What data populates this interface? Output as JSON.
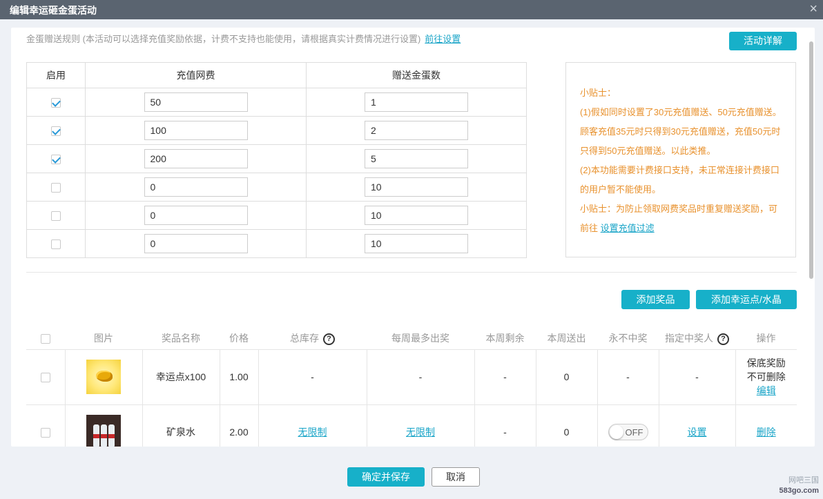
{
  "dialog": {
    "title": "编辑幸运砸金蛋活动",
    "close_icon": "×"
  },
  "rule": {
    "description": "金蛋赠送规则 (本活动可以选择充值奖励依据，计费不支持也能使用，请根据真实计费情况进行设置)",
    "link": "前往设置",
    "detail_button": "活动详解"
  },
  "gift_table": {
    "headers": [
      "启用",
      "充值网费",
      "赠送金蛋数"
    ],
    "rows": [
      {
        "enabled": true,
        "recharge": "50",
        "eggs": "1"
      },
      {
        "enabled": true,
        "recharge": "100",
        "eggs": "2"
      },
      {
        "enabled": true,
        "recharge": "200",
        "eggs": "5"
      },
      {
        "enabled": false,
        "recharge": "0",
        "eggs": "10"
      },
      {
        "enabled": false,
        "recharge": "0",
        "eggs": "10"
      },
      {
        "enabled": false,
        "recharge": "0",
        "eggs": "10"
      }
    ]
  },
  "tips": {
    "title": "小贴士：",
    "line1": "(1)假如同时设置了30元充值赠送、50元充值赠送。顾客充值35元时只得到30元充值赠送，充值50元时只得到50元充值赠送。以此类推。",
    "line2": "(2)本功能需要计费接口支持，未正常连接计费接口的用户暂不能使用。",
    "line3": "小贴士：为防止领取网费奖品时重复赠送奖励，可前往",
    "link": "设置充值过滤"
  },
  "prize_actions": {
    "add_prize": "添加奖品",
    "add_lucky": "添加幸运点/水晶"
  },
  "prize_table": {
    "headers": {
      "image": "图片",
      "name": "奖品名称",
      "price": "价格",
      "stock": "总库存",
      "weekly_max": "每周最多出奖",
      "week_left": "本周剩余",
      "week_sent": "本周送出",
      "never_win": "永不中奖",
      "winner": "指定中奖人",
      "ops": "操作"
    },
    "help_glyph": "?",
    "rows": [
      {
        "image": "gold-nugget",
        "name": "幸运点x100",
        "price": "1.00",
        "stock": "-",
        "weekly_max": "-",
        "week_left": "-",
        "week_sent": "0",
        "never_win": "-",
        "winner": "-",
        "ops_text1": "保底奖励",
        "ops_text2": "不可删除",
        "ops_link": "编辑"
      },
      {
        "image": "mineral-water",
        "name": "矿泉水",
        "price": "2.00",
        "stock": "无限制",
        "weekly_max": "无限制",
        "week_left": "-",
        "week_sent": "0",
        "never_win_toggle": "OFF",
        "winner_link": "设置",
        "ops_link": "删除"
      }
    ]
  },
  "footer": {
    "save": "确定并保存",
    "cancel": "取消"
  },
  "watermark": {
    "line1": "网吧三国",
    "line2": "583go.com"
  },
  "colors": {
    "accent": "#17b0c9",
    "link": "#1aa5c8",
    "tips": "#e8912d",
    "titlebar": "#5a6470"
  }
}
